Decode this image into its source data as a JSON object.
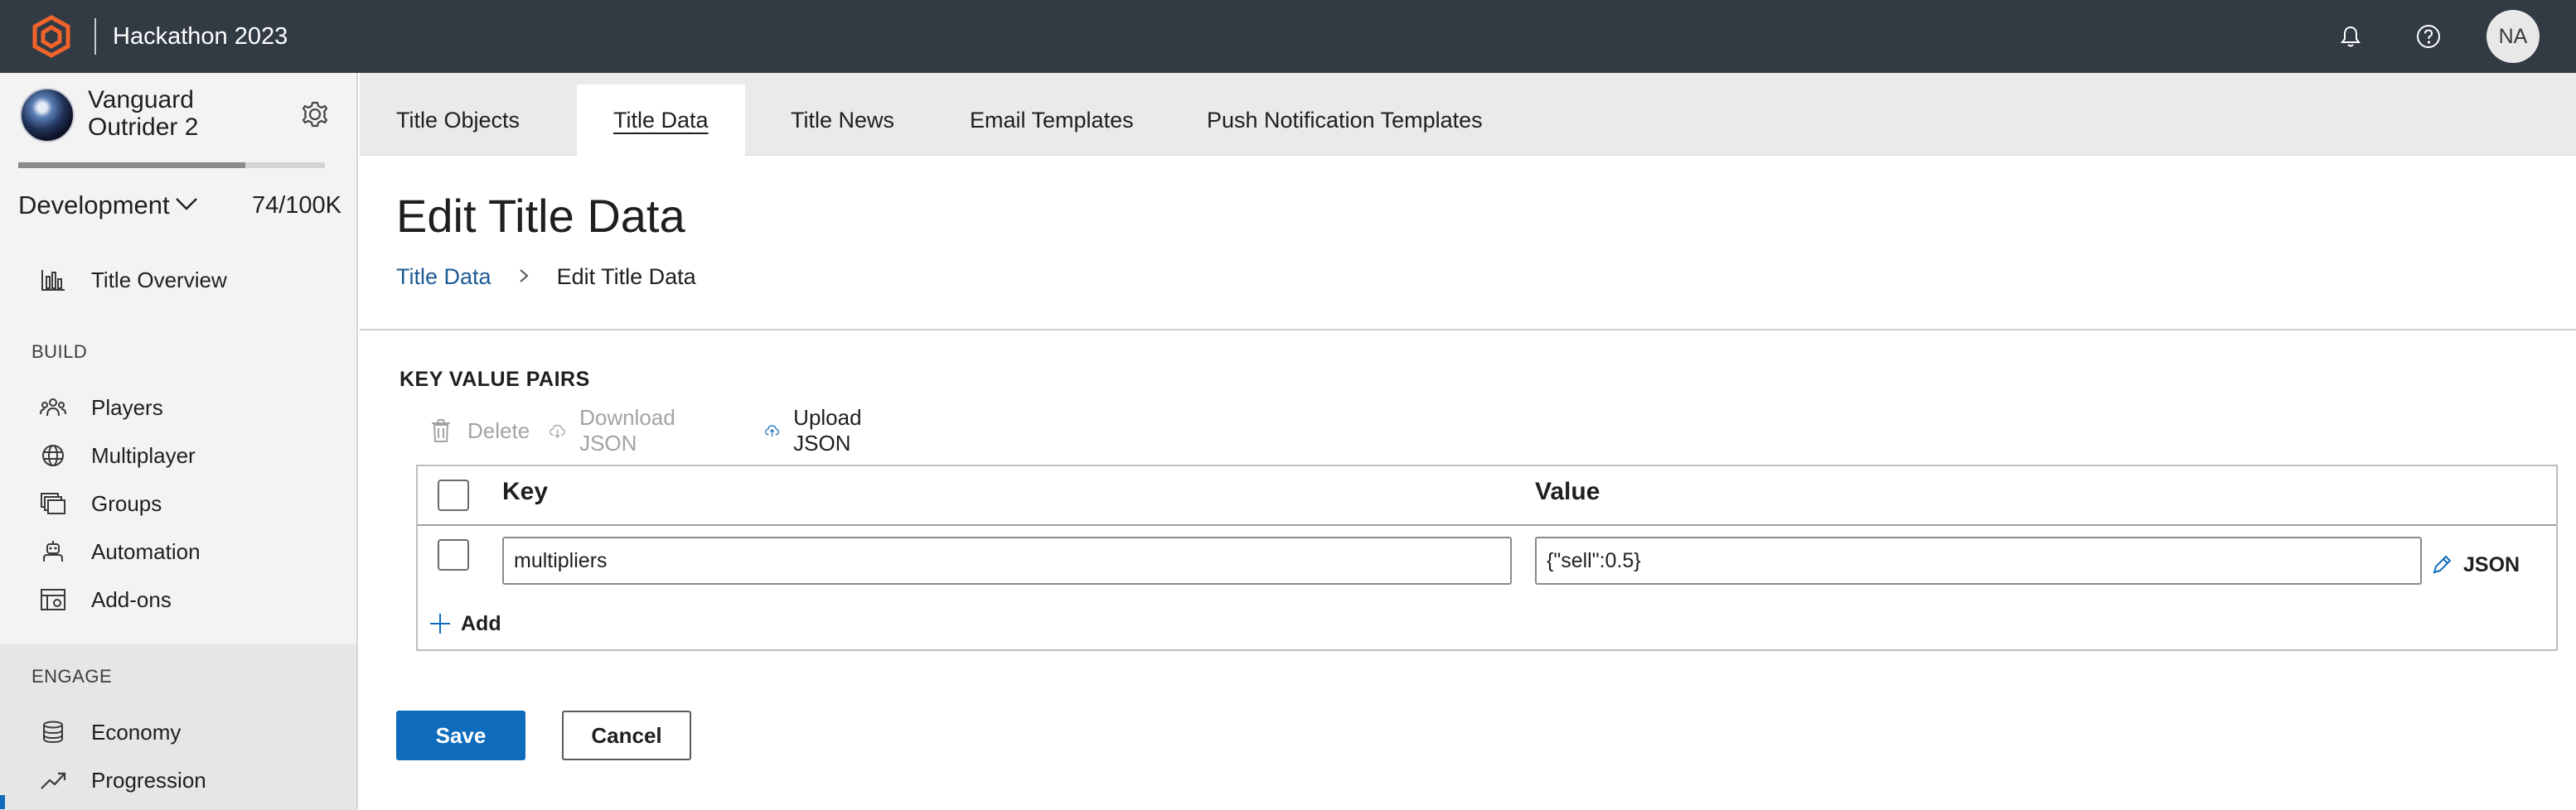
{
  "topbar": {
    "app_title": "Hackathon 2023",
    "avatar_initials": "NA",
    "icons": [
      "logo-icon",
      "bell-icon",
      "help-icon"
    ],
    "bg_color": "#323a44",
    "brand_color": "#f0642c"
  },
  "sidebar": {
    "game_name": "Vanguard Outrider 2",
    "environment": "Development",
    "usage": "74/100K",
    "usage_fraction": 0.74,
    "overview_item": {
      "label": "Title Overview",
      "icon": "bar-chart-icon"
    },
    "build_label": "BUILD",
    "build_items": [
      {
        "label": "Players",
        "icon": "players-icon"
      },
      {
        "label": "Multiplayer",
        "icon": "globe-icon"
      },
      {
        "label": "Groups",
        "icon": "groups-icon"
      },
      {
        "label": "Automation",
        "icon": "automation-icon"
      },
      {
        "label": "Add-ons",
        "icon": "addons-icon"
      }
    ],
    "engage_label": "ENGAGE",
    "engage_items": [
      {
        "label": "Economy",
        "icon": "economy-icon"
      },
      {
        "label": "Progression",
        "icon": "progression-icon"
      }
    ]
  },
  "tabs": [
    {
      "label": "Title Objects",
      "active": false
    },
    {
      "label": "Title Data",
      "active": true
    },
    {
      "label": "Title News",
      "active": false
    },
    {
      "label": "Email Templates",
      "active": false
    },
    {
      "label": "Push Notification Templates",
      "active": false
    }
  ],
  "main": {
    "page_title": "Edit Title Data",
    "breadcrumb": {
      "parent": "Title Data",
      "separator": ">",
      "current": "Edit Title Data"
    },
    "section_title": "KEY VALUE PAIRS",
    "toolbar": {
      "delete_label": "Delete",
      "download_label": "Download JSON",
      "upload_label": "Upload JSON"
    },
    "table": {
      "key_header": "Key",
      "value_header": "Value",
      "rows": [
        {
          "key": "multipliers",
          "value": "{\"sell\":0.5}",
          "json_label": "JSON"
        }
      ],
      "add_label": "Add"
    },
    "save_label": "Save",
    "cancel_label": "Cancel",
    "accent_color": "#0f6cbd"
  }
}
